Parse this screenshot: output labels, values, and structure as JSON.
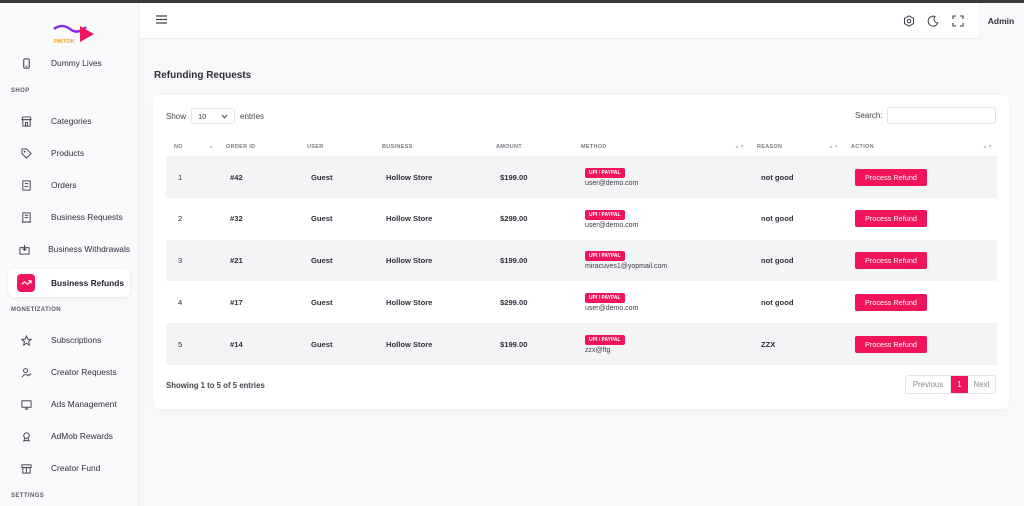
{
  "brand": {
    "logo_text": "PIKTOK"
  },
  "sidebar": {
    "items_top": [
      {
        "label": "Dummy Lives",
        "icon": "phone-icon"
      }
    ],
    "section_shop": "SHOP",
    "shop_items": [
      {
        "label": "Categories",
        "icon": "store-icon"
      },
      {
        "label": "Products",
        "icon": "tag-icon"
      },
      {
        "label": "Orders",
        "icon": "receipt-icon"
      },
      {
        "label": "Business Requests",
        "icon": "building-icon"
      },
      {
        "label": "Business Withdrawals",
        "icon": "withdraw-icon"
      },
      {
        "label": "Business Refunds",
        "icon": "refund-icon",
        "active": true
      }
    ],
    "section_monetization": "MONETIZATION",
    "monetization_items": [
      {
        "label": "Subscriptions",
        "icon": "star-icon"
      },
      {
        "label": "Creator Requests",
        "icon": "user-check-icon"
      },
      {
        "label": "Ads Management",
        "icon": "monitor-icon"
      },
      {
        "label": "AdMob Rewards",
        "icon": "reward-icon"
      },
      {
        "label": "Creator Fund",
        "icon": "fund-icon"
      }
    ],
    "section_settings": "SETTINGS"
  },
  "header": {
    "admin_label": "Admin"
  },
  "page": {
    "title": "Refunding Requests"
  },
  "table_controls": {
    "show_label": "Show",
    "entries_value": "10",
    "entries_label": "entries",
    "search_label": "Search:"
  },
  "table": {
    "columns": [
      "NO",
      "ORDER ID",
      "USER",
      "BUSINESS",
      "AMOUNT",
      "METHOD",
      "REASON",
      "ACTION"
    ],
    "rows": [
      {
        "no": "1",
        "order_id": "#42",
        "user": "Guest",
        "business": "Hollow Store",
        "amount": "$199.00",
        "method": "UPI / PAYPAL",
        "email": "user@demo.com",
        "reason": "not good",
        "action": "Process Refund"
      },
      {
        "no": "2",
        "order_id": "#32",
        "user": "Guest",
        "business": "Hollow Store",
        "amount": "$299.00",
        "method": "UPI / PAYPAL",
        "email": "user@demo.com",
        "reason": "not good",
        "action": "Process Refund"
      },
      {
        "no": "3",
        "order_id": "#21",
        "user": "Guest",
        "business": "Hollow Store",
        "amount": "$199.00",
        "method": "UPI / PAYPAL",
        "email": "miracuves1@yopmail.com",
        "reason": "not good",
        "action": "Process Refund"
      },
      {
        "no": "4",
        "order_id": "#17",
        "user": "Guest",
        "business": "Hollow Store",
        "amount": "$299.00",
        "method": "UPI / PAYPAL",
        "email": "user@demo.com",
        "reason": "not good",
        "action": "Process Refund"
      },
      {
        "no": "5",
        "order_id": "#14",
        "user": "Guest",
        "business": "Hollow Store",
        "amount": "$199.00",
        "method": "UPI / PAYPAL",
        "email": "zzx@ftg",
        "reason": "ZZX",
        "action": "Process Refund"
      }
    ]
  },
  "footer": {
    "showing_text": "Showing 1 to 5 of 5 entries",
    "prev_label": "Previous",
    "page_number": "1",
    "next_label": "Next"
  },
  "colors": {
    "accent": "#f0145a"
  }
}
